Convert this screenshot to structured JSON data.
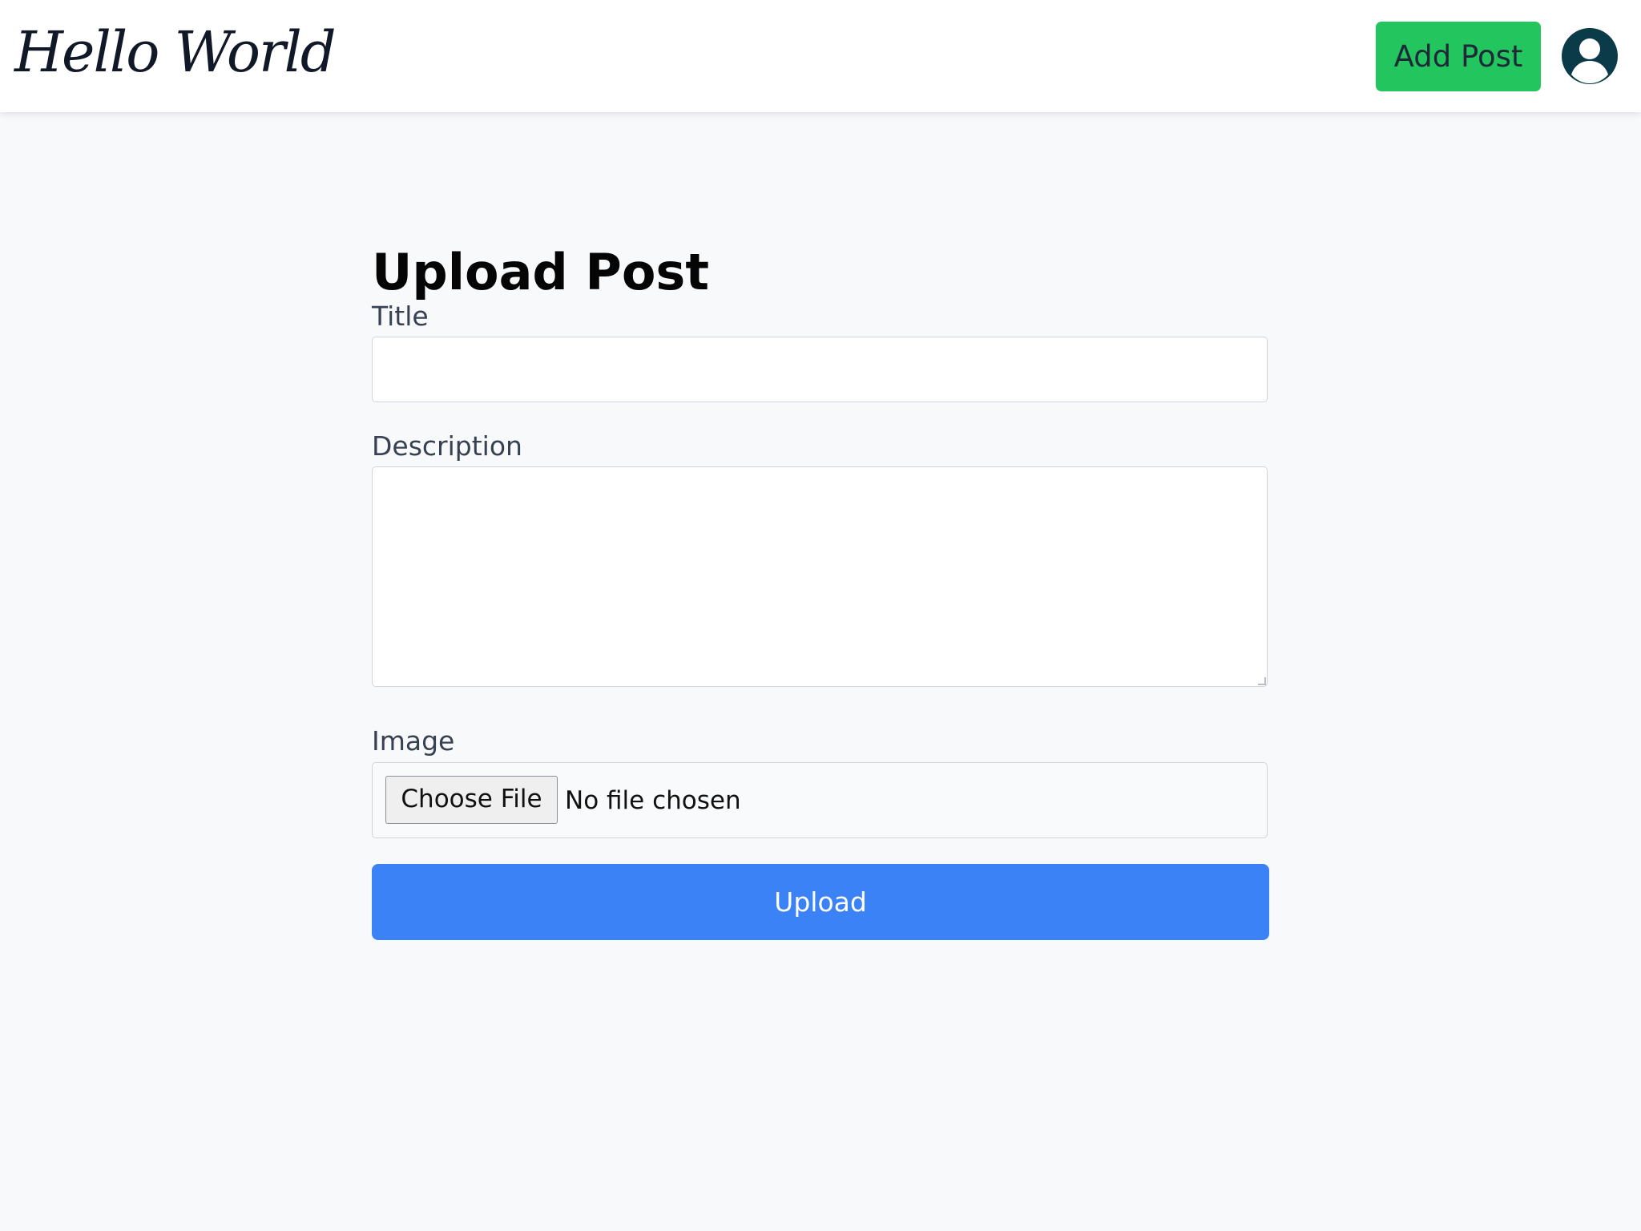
{
  "header": {
    "brand": "Hello World",
    "add_post_label": "Add Post",
    "avatar_icon": "user-circle-icon"
  },
  "form": {
    "title": "Upload Post",
    "title_label": "Title",
    "title_value": "",
    "title_placeholder": "",
    "description_label": "Description",
    "description_value": "",
    "description_placeholder": "",
    "image_label": "Image",
    "choose_file_label": "Choose File",
    "file_status": "No file chosen",
    "upload_label": "Upload"
  },
  "colors": {
    "page_background": "#f8f9fb",
    "add_post_button": "#22c55e",
    "upload_button": "#3b82f6",
    "avatar_icon": "#0b3a48"
  }
}
